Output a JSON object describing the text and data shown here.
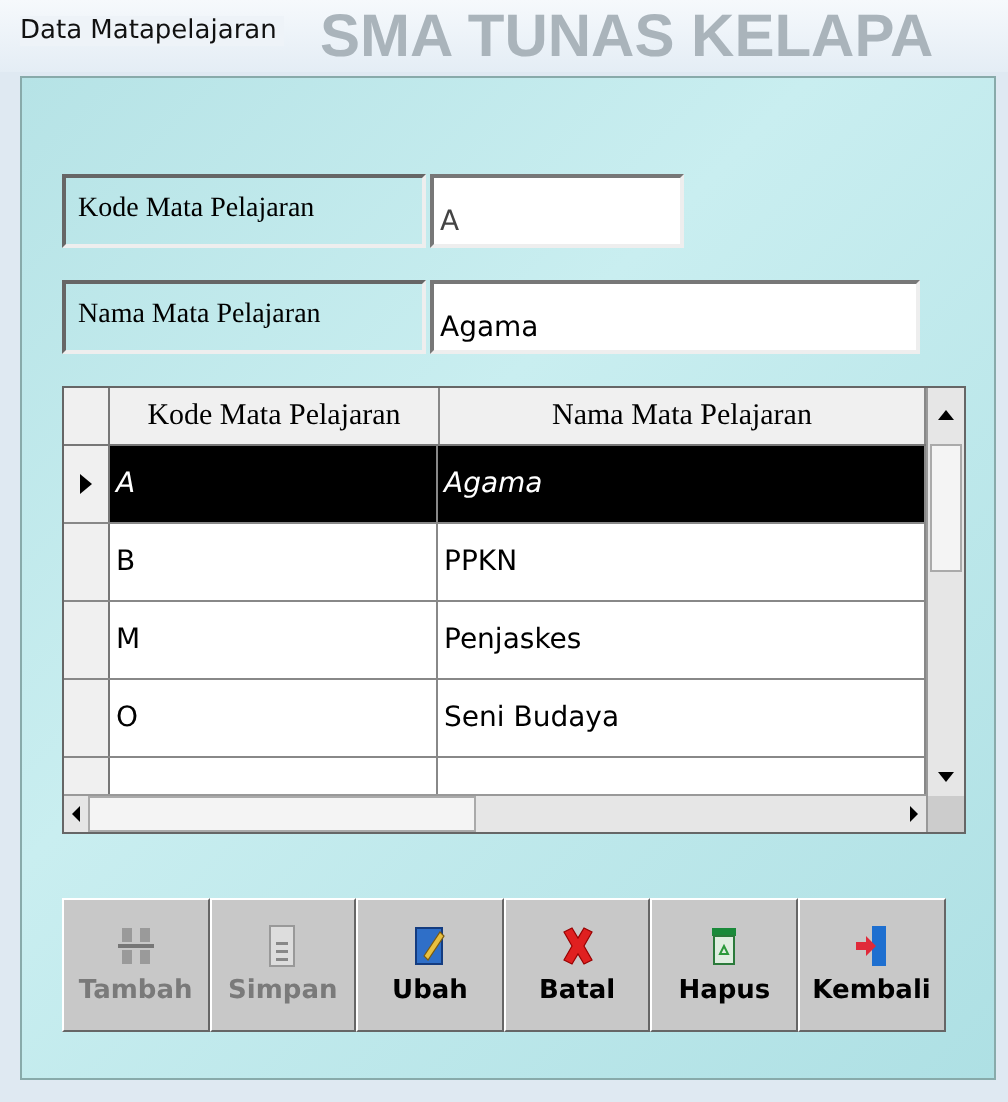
{
  "window": {
    "title": "Data Matapelajaran"
  },
  "background_title": "SMA TUNAS KELAPA",
  "form": [
    {
      "label": "Kode Mata Pelajaran",
      "value": "A",
      "wide": false
    },
    {
      "label": "Nama Mata Pelajaran",
      "value": "Agama",
      "wide": true
    }
  ],
  "table": {
    "columns": [
      "Kode Mata Pelajaran",
      "Nama Mata Pelajaran"
    ],
    "rows": [
      {
        "cells": [
          "A",
          "Agama"
        ],
        "selected": true
      },
      {
        "cells": [
          "B",
          "PPKN"
        ],
        "selected": false
      },
      {
        "cells": [
          "M",
          "Penjaskes"
        ],
        "selected": false
      },
      {
        "cells": [
          "O",
          "Seni Budaya"
        ],
        "selected": false
      }
    ]
  },
  "buttons": [
    {
      "label": "Tambah",
      "kind": "add",
      "disabled": true
    },
    {
      "label": "Simpan",
      "kind": "save",
      "disabled": true
    },
    {
      "label": "Ubah",
      "kind": "edit",
      "disabled": false
    },
    {
      "label": "Batal",
      "kind": "cancel",
      "disabled": false
    },
    {
      "label": "Hapus",
      "kind": "delete",
      "disabled": false
    },
    {
      "label": "Kembali",
      "kind": "exit",
      "disabled": false
    }
  ]
}
